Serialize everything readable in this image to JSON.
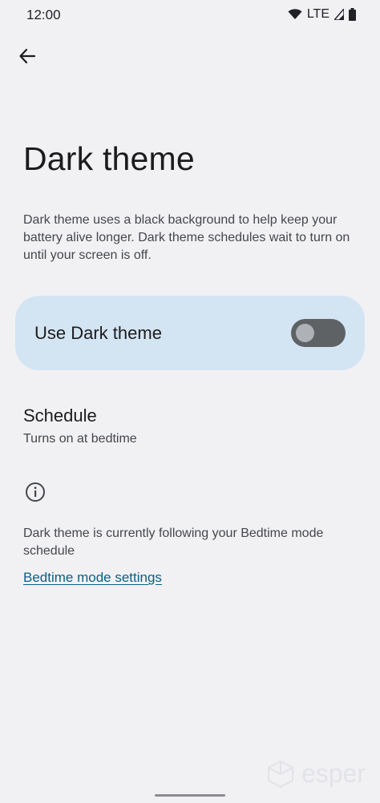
{
  "status_bar": {
    "time": "12:00",
    "network": "LTE"
  },
  "header": {
    "back_icon": "arrow-left-icon"
  },
  "page": {
    "title": "Dark theme",
    "description": "Dark theme uses a black background to help keep your battery alive longer. Dark theme schedules wait to turn on until your screen is off."
  },
  "toggle": {
    "label": "Use Dark theme",
    "state": "off",
    "card_color": "#d3e4f3"
  },
  "schedule": {
    "title": "Schedule",
    "summary": "Turns on at bedtime"
  },
  "info": {
    "icon": "info-icon",
    "text": "Dark theme is currently following your Bedtime mode schedule",
    "link_label": "Bedtime mode settings",
    "link_color": "#0b5f84"
  },
  "watermark": {
    "text": "esper"
  }
}
